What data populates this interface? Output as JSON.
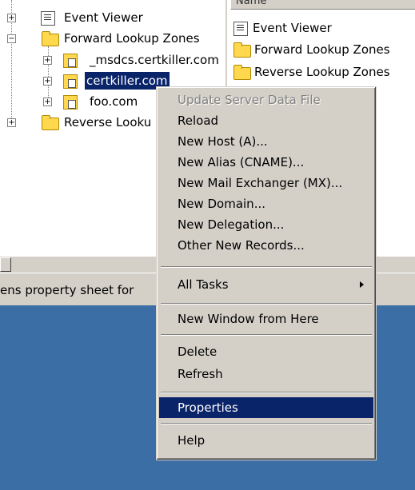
{
  "tree": {
    "items": [
      {
        "label": "Event Viewer"
      },
      {
        "label": "Forward Lookup Zones"
      },
      {
        "label": "_msdcs.certkiller.com"
      },
      {
        "label": "certkiller.com"
      },
      {
        "label": "foo.com"
      },
      {
        "label": "Reverse Looku"
      }
    ]
  },
  "list": {
    "header": "Name",
    "items": [
      {
        "label": "Event Viewer"
      },
      {
        "label": "Forward Lookup Zones"
      },
      {
        "label": "Reverse Lookup Zones"
      }
    ]
  },
  "status": {
    "text": "ens property sheet for"
  },
  "menu": {
    "items": [
      {
        "label": "Update Server Data File",
        "disabled": true
      },
      {
        "label": "Reload"
      },
      {
        "label": "New Host (A)..."
      },
      {
        "label": "New Alias (CNAME)..."
      },
      {
        "label": "New Mail Exchanger (MX)..."
      },
      {
        "label": "New Domain..."
      },
      {
        "label": "New Delegation..."
      },
      {
        "label": "Other New Records..."
      },
      {
        "label": "All Tasks",
        "submenu": true
      },
      {
        "label": "New Window from Here"
      },
      {
        "label": "Delete"
      },
      {
        "label": "Refresh"
      },
      {
        "label": "Properties",
        "selected": true
      },
      {
        "label": "Help"
      }
    ]
  },
  "colors": {
    "selection": "#0a246a",
    "menu_bg": "#d4d0c8",
    "desktop": "#3a6ea5"
  }
}
